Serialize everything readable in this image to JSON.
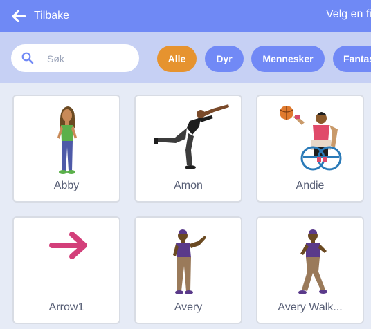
{
  "header": {
    "back_label": "Tilbake",
    "title": "Velg en figur"
  },
  "search": {
    "placeholder": "Søk",
    "value": ""
  },
  "tags": [
    "Alle",
    "Dyr",
    "Mennesker",
    "Fantasi"
  ],
  "sprites": [
    {
      "name": "Abby"
    },
    {
      "name": "Amon"
    },
    {
      "name": "Andie"
    },
    {
      "name": "Arrow1"
    },
    {
      "name": "Avery"
    },
    {
      "name": "Avery Walk..."
    }
  ],
  "colors": {
    "header": "#6f89f5",
    "filter_bar": "#c6d0f4",
    "tag": "#7189f6",
    "tag_active": "#e6932f",
    "text": "#575e75"
  },
  "icons": [
    "arrow-left-icon",
    "search-icon"
  ]
}
